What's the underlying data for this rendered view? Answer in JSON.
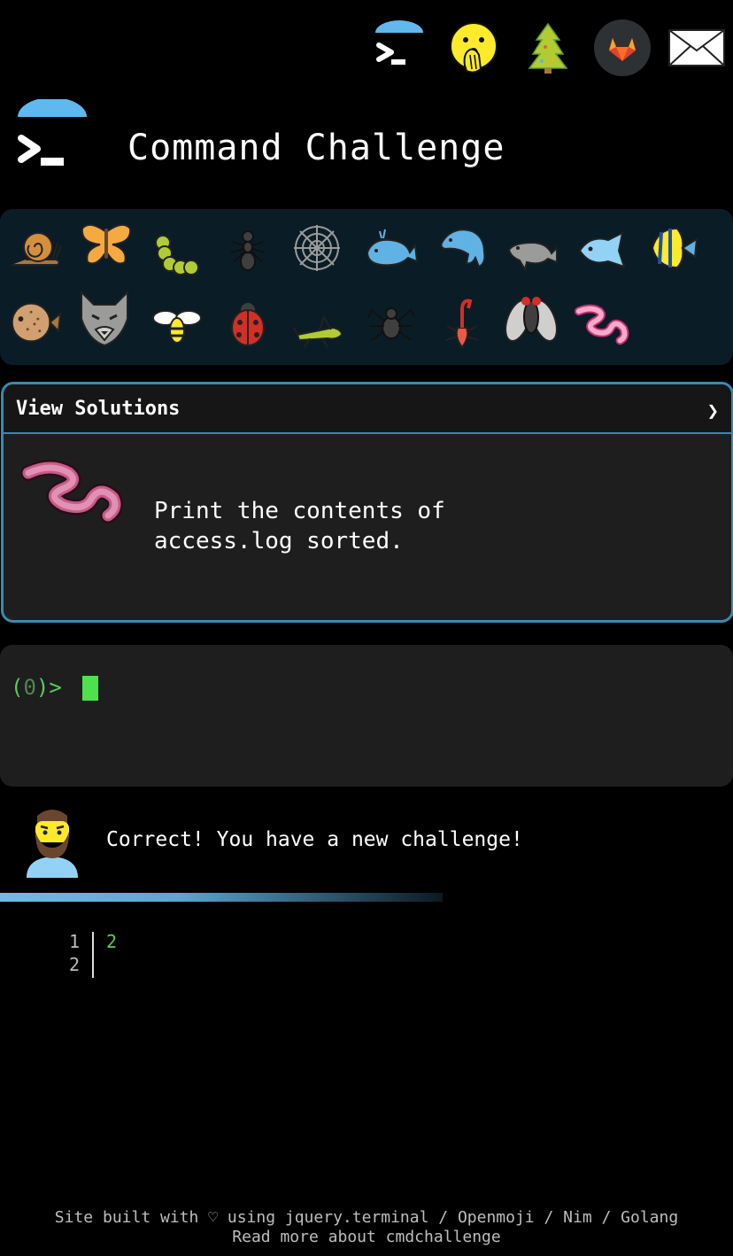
{
  "nav": {
    "items": [
      {
        "name": "terminal-logo-icon"
      },
      {
        "name": "hand-over-mouth-emoji-icon"
      },
      {
        "name": "christmas-tree-icon"
      },
      {
        "name": "gitlab-icon"
      },
      {
        "name": "mail-icon"
      }
    ]
  },
  "header": {
    "title": "Command Challenge"
  },
  "critters": {
    "row1": [
      "snail-icon",
      "butterfly-icon",
      "caterpillar-icon",
      "ant-icon",
      "spider-web-icon",
      "whale-icon",
      "dolphin-icon",
      "dolphin-2-icon",
      "fish-icon",
      "tropical-fish-icon"
    ],
    "row2": [
      "blowfish-icon",
      "wolf-icon",
      "bee-icon",
      "ladybug-icon",
      "cricket-icon",
      "spider-icon",
      "scorpion-icon",
      "fly-icon",
      "worm-icon"
    ]
  },
  "panel": {
    "header_label": "View Solutions",
    "chevron": "❯",
    "challenge_line1": "Print the contents of",
    "challenge_line2": "access.log sorted."
  },
  "terminal": {
    "prompt_open": "(",
    "prompt_count": "0",
    "prompt_close": ")>"
  },
  "feedback": {
    "message": "Correct! You have a new challenge!"
  },
  "output": {
    "line_numbers": [
      "1",
      "2"
    ],
    "lines": [
      "2",
      ""
    ]
  },
  "footer": {
    "line1": "Site built with ♡ using jquery.terminal / Openmoji / Nim / Golang",
    "line2": "Read more about cmdchallenge"
  },
  "colors": {
    "accent": "#3d88b0",
    "prompt": "#5acc5a",
    "cursor": "#4fe04f",
    "panel_bg": "#1e1e1e"
  }
}
